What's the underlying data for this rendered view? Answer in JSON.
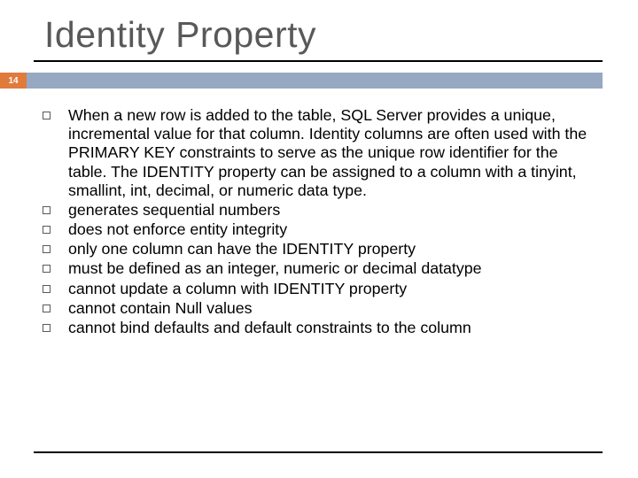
{
  "slide": {
    "title": "Identity Property",
    "page_number": "14",
    "bullets": [
      "When a new row is added to the table, SQL Server provides a unique, incremental value for that column. Identity columns are often used with the PRIMARY KEY constraints to serve as the unique row identifier for the table. The IDENTITY property can be assigned to a column with a tinyint, smallint, int, decimal, or numeric data type.",
      "generates sequential numbers",
      "does not enforce entity integrity",
      "only one column can have the IDENTITY property",
      "must be defined as an integer, numeric or decimal datatype",
      "cannot update a column with IDENTITY property",
      "cannot contain Null values",
      "cannot bind defaults and default constraints to the column"
    ]
  }
}
